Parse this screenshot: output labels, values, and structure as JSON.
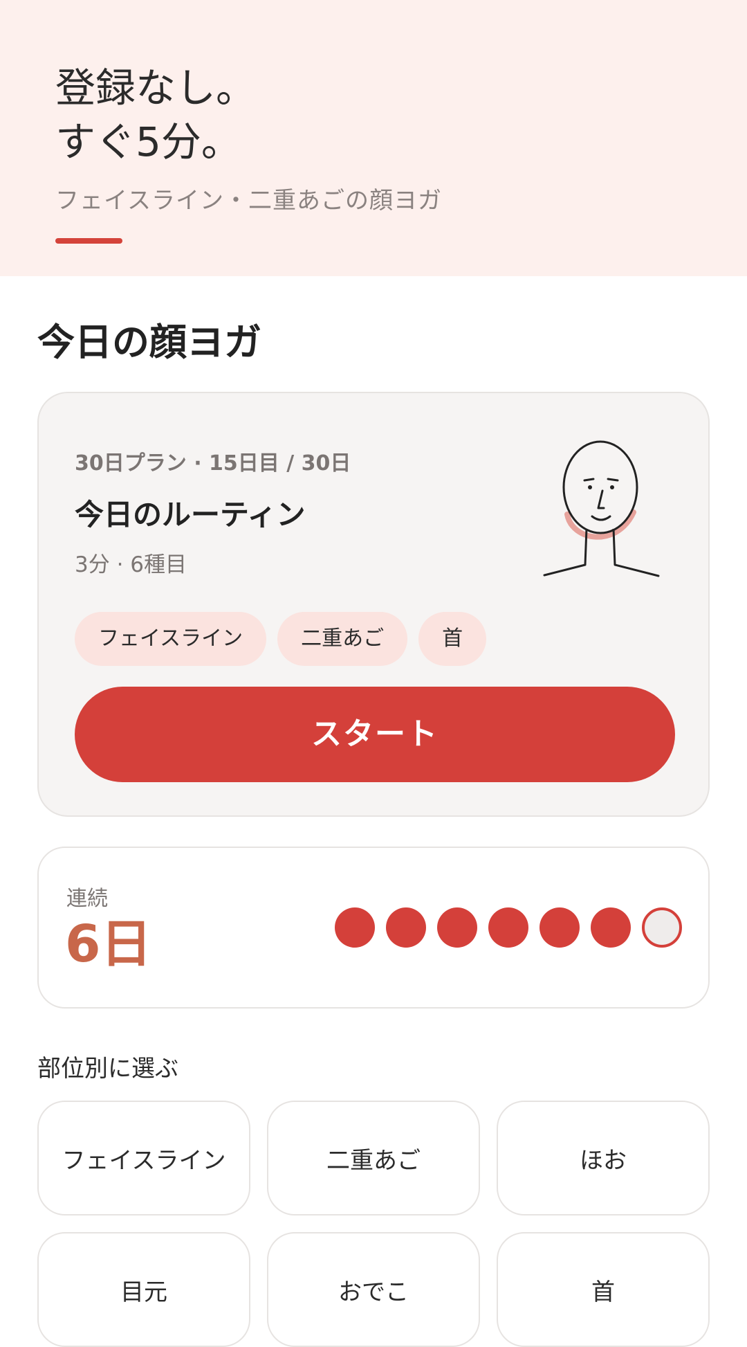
{
  "hero": {
    "title_line1": "登録なし。",
    "title_line2": "すぐ5分。",
    "subtitle": "フェイスライン・二重あごの顔ヨガ",
    "accent_color": "#d4433a"
  },
  "today": {
    "section_title": "今日の顔ヨガ",
    "plan_meta": "30日プラン · 15日目 / 30日",
    "routine_title": "今日のルーティン",
    "routine_detail": "3分 · 6種目",
    "illustration_icon": "face-outline-jawline-highlight-icon",
    "tags": [
      "フェイスライン",
      "二重あご",
      "首"
    ],
    "start_label": "スタート"
  },
  "streak": {
    "label": "連続",
    "value": "6日",
    "completed_days": 6,
    "total_days": 7
  },
  "parts": {
    "title": "部位別に選ぶ",
    "items": [
      "フェイスライン",
      "二重あご",
      "ほお",
      "目元",
      "おでこ",
      "首"
    ]
  },
  "colors": {
    "primary": "#d4403a",
    "streak_value": "#c8674a",
    "hero_bg": "#fdf0ed",
    "chip_bg": "#fbe3df"
  }
}
